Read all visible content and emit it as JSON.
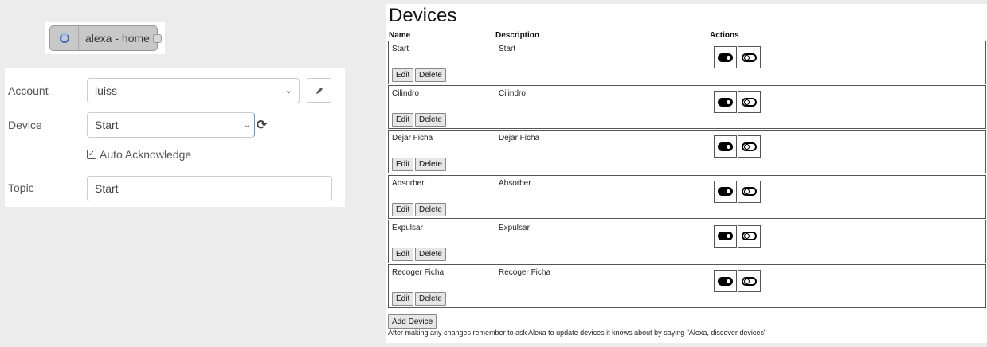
{
  "node": {
    "label": "alexa - home",
    "icon": "loading-ring-icon",
    "accent": "#2b6bd6"
  },
  "form": {
    "account_label": "Account",
    "account_value": "luiss",
    "device_label": "Device",
    "device_value": "Start",
    "auto_ack_label": "Auto Acknowledge",
    "auto_ack_checked": true,
    "topic_label": "Topic",
    "topic_value": "Start",
    "edit_icon": "pencil-icon",
    "refresh_icon": "refresh-icon"
  },
  "devices": {
    "title": "Devices",
    "headers": {
      "name": "Name",
      "description": "Description",
      "actions": "Actions"
    },
    "edit_label": "Edit",
    "delete_label": "Delete",
    "rows": [
      {
        "name": "Start",
        "description": "Start"
      },
      {
        "name": "Cilindro",
        "description": "Cilindro"
      },
      {
        "name": "Dejar Ficha",
        "description": "Dejar Ficha"
      },
      {
        "name": "Absorber",
        "description": "Absorber"
      },
      {
        "name": "Expulsar",
        "description": "Expulsar"
      },
      {
        "name": "Recoger Ficha",
        "description": "Recoger Ficha"
      }
    ],
    "add_label": "Add Device",
    "footnote": "After making any changes remember to ask Alexa to update devices it knows about by saying \"Alexa, discover devices\""
  }
}
